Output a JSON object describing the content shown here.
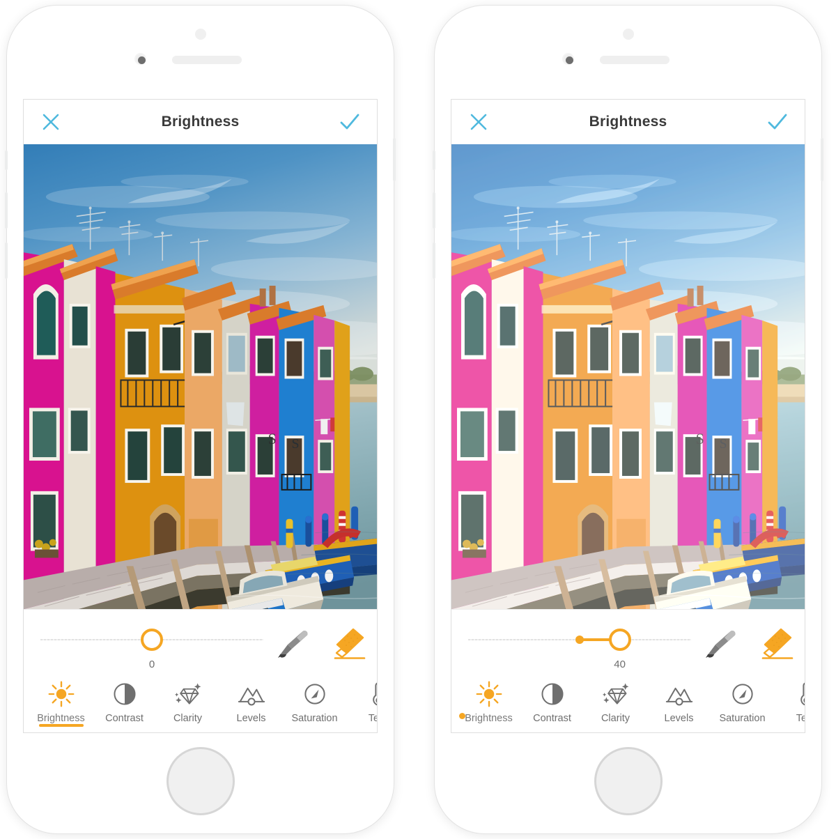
{
  "app": {
    "accent_color": "#f5a623",
    "action_color": "#4fb9de",
    "title_color": "#3a3a3a",
    "label_color": "#6f6f6f"
  },
  "phones": [
    {
      "id": "phone-before",
      "header": {
        "title": "Brightness",
        "close_icon": "close-icon",
        "confirm_icon": "check-icon"
      },
      "photo": {
        "alt": "Colorful Burano canal houses with moored boats",
        "variant": "normal"
      },
      "slider": {
        "value": "0",
        "value_number": 0,
        "percent": 50,
        "anchor_percent": 50,
        "show_fill": false
      },
      "tools": [
        {
          "name": "brush-tool-icon",
          "label": "Brush",
          "active": false
        },
        {
          "name": "eraser-tool-icon",
          "label": "Eraser",
          "active": true
        }
      ],
      "adjustments": [
        {
          "label": "Brightness",
          "icon": "sun-icon",
          "active": true,
          "marker": "underline"
        },
        {
          "label": "Contrast",
          "icon": "contrast-icon",
          "active": false,
          "marker": "none"
        },
        {
          "label": "Clarity",
          "icon": "diamond-icon",
          "active": false,
          "marker": "none"
        },
        {
          "label": "Levels",
          "icon": "mountains-icon",
          "active": false,
          "marker": "none"
        },
        {
          "label": "Saturation",
          "icon": "gauge-icon",
          "active": false,
          "marker": "none"
        },
        {
          "label": "Tem",
          "icon": "thermometer-icon",
          "active": false,
          "marker": "none"
        }
      ]
    },
    {
      "id": "phone-after",
      "header": {
        "title": "Brightness",
        "close_icon": "close-icon",
        "confirm_icon": "check-icon"
      },
      "photo": {
        "alt": "Colorful Burano canal houses with moored boats, brightened",
        "variant": "bright"
      },
      "slider": {
        "value": "40",
        "value_number": 40,
        "percent": 68,
        "anchor_percent": 50,
        "show_fill": true
      },
      "tools": [
        {
          "name": "brush-tool-icon",
          "label": "Brush",
          "active": false
        },
        {
          "name": "eraser-tool-icon",
          "label": "Eraser",
          "active": true
        }
      ],
      "adjustments": [
        {
          "label": "Brightness",
          "icon": "sun-icon",
          "active": true,
          "marker": "dot"
        },
        {
          "label": "Contrast",
          "icon": "contrast-icon",
          "active": false,
          "marker": "none"
        },
        {
          "label": "Clarity",
          "icon": "diamond-icon",
          "active": false,
          "marker": "none"
        },
        {
          "label": "Levels",
          "icon": "mountains-icon",
          "active": false,
          "marker": "none"
        },
        {
          "label": "Saturation",
          "icon": "gauge-icon",
          "active": false,
          "marker": "none"
        },
        {
          "label": "Tem",
          "icon": "thermometer-icon",
          "active": false,
          "marker": "none"
        }
      ]
    }
  ]
}
